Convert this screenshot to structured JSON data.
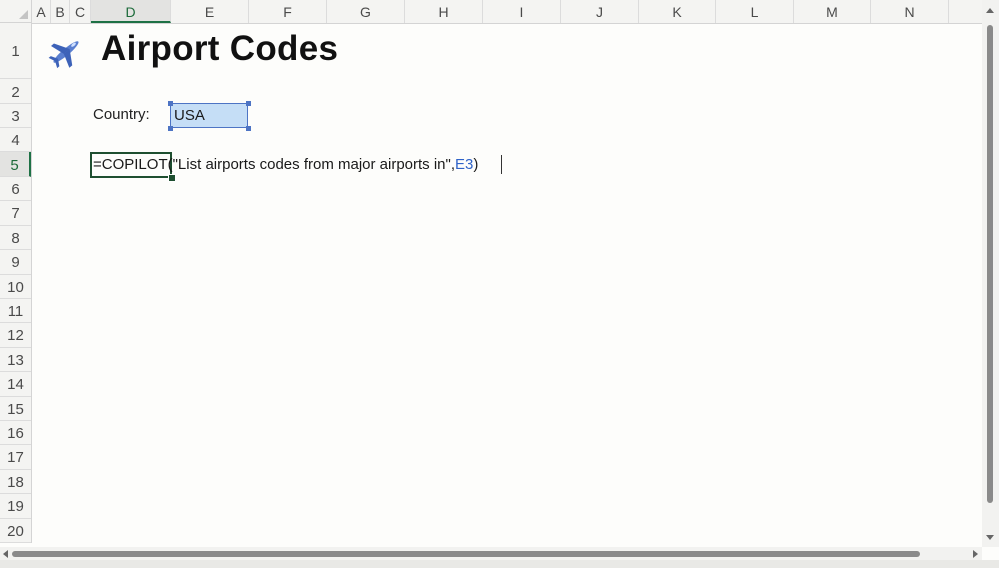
{
  "columns": [
    "A",
    "B",
    "C",
    "D",
    "E",
    "F",
    "G",
    "H",
    "I",
    "J",
    "K",
    "L",
    "M",
    "N"
  ],
  "rows": [
    "1",
    "2",
    "3",
    "4",
    "5",
    "6",
    "7",
    "8",
    "9",
    "10",
    "11",
    "12",
    "13",
    "14",
    "15",
    "16",
    "17",
    "18",
    "19",
    "20"
  ],
  "active_column": "D",
  "active_row": "5",
  "sheet": {
    "title_icon": "airplane-icon",
    "title": "Airport Codes",
    "country_label": "Country:",
    "country_value": "USA",
    "formula": {
      "prefix": "=COPILOT",
      "args": "(\"List airports codes from major airports in\",",
      "ref": "E3",
      "suffix": ")"
    }
  },
  "colors": {
    "selection_fill": "#c5def6",
    "selection_border": "#4d74c4",
    "active_header": "#1e7145",
    "cell_ref": "#2f63c8"
  }
}
